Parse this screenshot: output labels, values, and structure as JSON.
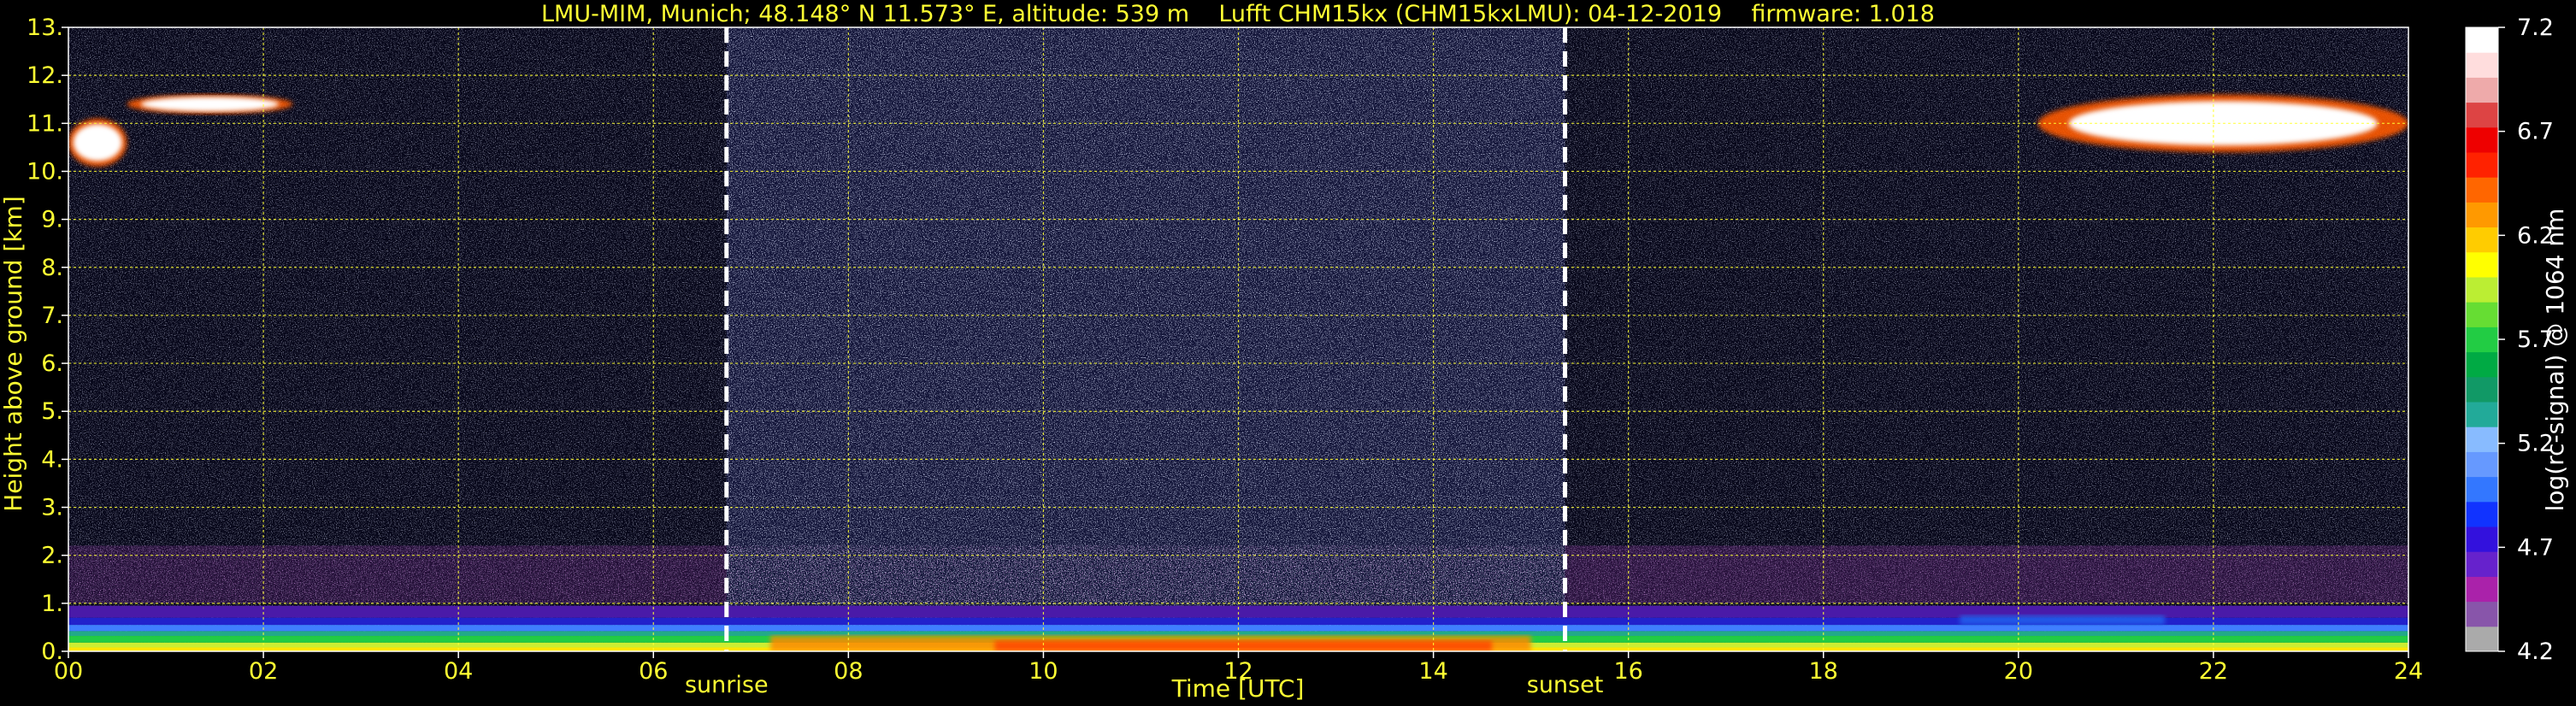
{
  "chart_data": {
    "type": "heatmap",
    "title": "LMU-MIM, Munich; 48.148° N 11.573° E, altitude: 539 m    Lufft CHM15kx (CHM15kxLMU): 04-12-2019    firmware: 1.018",
    "xlabel": "Time [UTC]",
    "ylabel": "Height above ground [km]",
    "xlim": [
      0,
      24
    ],
    "ylim": [
      0,
      13
    ],
    "grid": true,
    "xticks": [
      0,
      2,
      4,
      6,
      8,
      10,
      12,
      14,
      16,
      18,
      20,
      22,
      24
    ],
    "xtick_labels": [
      "00",
      "02",
      "04",
      "06",
      "08",
      "10",
      "12",
      "14",
      "16",
      "18",
      "20",
      "22",
      "24"
    ],
    "yticks": [
      0,
      1,
      2,
      3,
      4,
      5,
      6,
      7,
      8,
      9,
      10,
      11,
      12,
      13
    ],
    "ytick_labels": [
      "0.",
      "1.",
      "2.",
      "3.",
      "4.",
      "5.",
      "6.",
      "7.",
      "8.",
      "9.",
      "10.",
      "11.",
      "12.",
      "13."
    ],
    "annotations": [
      {
        "label": "sunrise",
        "x": 6.75
      },
      {
        "label": "sunset",
        "x": 15.35
      }
    ],
    "features": {
      "boundary_layer_top_km": 0.95,
      "aerosol_layer_km": [
        1.0,
        2.2
      ],
      "cirrus_clouds": [
        {
          "x_range": [
            0.0,
            0.6
          ],
          "y_range": [
            10.1,
            11.1
          ]
        },
        {
          "x_range": [
            0.6,
            2.3
          ],
          "y_range": [
            11.2,
            11.6
          ]
        },
        {
          "x_range": [
            20.2,
            24.0
          ],
          "y_range": [
            10.4,
            11.6
          ]
        }
      ]
    },
    "colorbar": {
      "label": "log(rc-signal) @ 1064 nm",
      "vmin": 4.2,
      "vmax": 7.2,
      "ticks": [
        4.2,
        4.7,
        5.2,
        5.7,
        6.2,
        6.7,
        7.2
      ],
      "tick_labels": [
        "4.2",
        "4.7",
        "5.2",
        "5.7",
        "6.2",
        "6.7",
        "7.2"
      ],
      "colors": [
        "#aaaaaa",
        "#8855aa",
        "#aa22aa",
        "#6622cc",
        "#3311dd",
        "#1133ff",
        "#3377ff",
        "#6699ff",
        "#88bbff",
        "#22aa99",
        "#119966",
        "#00aa44",
        "#22cc44",
        "#66dd33",
        "#bbee33",
        "#ffff00",
        "#ffcc00",
        "#ff9900",
        "#ff6600",
        "#ff2200",
        "#ee0000",
        "#dd4444",
        "#eeaaaa",
        "#ffdddd",
        "#ffffff"
      ]
    },
    "background_color": "#000000",
    "text_color": "#ffff33",
    "grid_color": "#ffff33"
  }
}
